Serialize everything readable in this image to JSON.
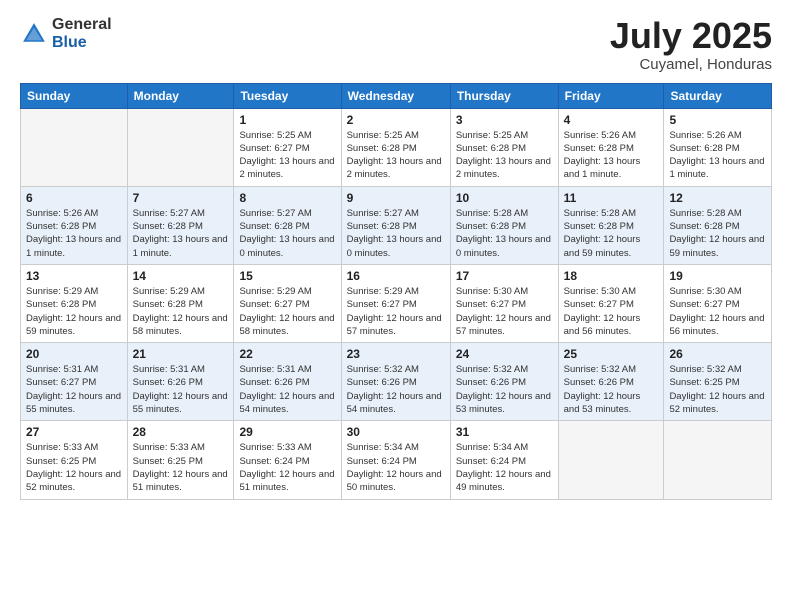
{
  "logo": {
    "general": "General",
    "blue": "Blue"
  },
  "title": "July 2025",
  "subtitle": "Cuyamel, Honduras",
  "days_of_week": [
    "Sunday",
    "Monday",
    "Tuesday",
    "Wednesday",
    "Thursday",
    "Friday",
    "Saturday"
  ],
  "weeks": [
    [
      {
        "day": "",
        "sunrise": "",
        "sunset": "",
        "daylight": ""
      },
      {
        "day": "",
        "sunrise": "",
        "sunset": "",
        "daylight": ""
      },
      {
        "day": "1",
        "sunrise": "Sunrise: 5:25 AM",
        "sunset": "Sunset: 6:27 PM",
        "daylight": "Daylight: 13 hours and 2 minutes."
      },
      {
        "day": "2",
        "sunrise": "Sunrise: 5:25 AM",
        "sunset": "Sunset: 6:28 PM",
        "daylight": "Daylight: 13 hours and 2 minutes."
      },
      {
        "day": "3",
        "sunrise": "Sunrise: 5:25 AM",
        "sunset": "Sunset: 6:28 PM",
        "daylight": "Daylight: 13 hours and 2 minutes."
      },
      {
        "day": "4",
        "sunrise": "Sunrise: 5:26 AM",
        "sunset": "Sunset: 6:28 PM",
        "daylight": "Daylight: 13 hours and 1 minute."
      },
      {
        "day": "5",
        "sunrise": "Sunrise: 5:26 AM",
        "sunset": "Sunset: 6:28 PM",
        "daylight": "Daylight: 13 hours and 1 minute."
      }
    ],
    [
      {
        "day": "6",
        "sunrise": "Sunrise: 5:26 AM",
        "sunset": "Sunset: 6:28 PM",
        "daylight": "Daylight: 13 hours and 1 minute."
      },
      {
        "day": "7",
        "sunrise": "Sunrise: 5:27 AM",
        "sunset": "Sunset: 6:28 PM",
        "daylight": "Daylight: 13 hours and 1 minute."
      },
      {
        "day": "8",
        "sunrise": "Sunrise: 5:27 AM",
        "sunset": "Sunset: 6:28 PM",
        "daylight": "Daylight: 13 hours and 0 minutes."
      },
      {
        "day": "9",
        "sunrise": "Sunrise: 5:27 AM",
        "sunset": "Sunset: 6:28 PM",
        "daylight": "Daylight: 13 hours and 0 minutes."
      },
      {
        "day": "10",
        "sunrise": "Sunrise: 5:28 AM",
        "sunset": "Sunset: 6:28 PM",
        "daylight": "Daylight: 13 hours and 0 minutes."
      },
      {
        "day": "11",
        "sunrise": "Sunrise: 5:28 AM",
        "sunset": "Sunset: 6:28 PM",
        "daylight": "Daylight: 12 hours and 59 minutes."
      },
      {
        "day": "12",
        "sunrise": "Sunrise: 5:28 AM",
        "sunset": "Sunset: 6:28 PM",
        "daylight": "Daylight: 12 hours and 59 minutes."
      }
    ],
    [
      {
        "day": "13",
        "sunrise": "Sunrise: 5:29 AM",
        "sunset": "Sunset: 6:28 PM",
        "daylight": "Daylight: 12 hours and 59 minutes."
      },
      {
        "day": "14",
        "sunrise": "Sunrise: 5:29 AM",
        "sunset": "Sunset: 6:28 PM",
        "daylight": "Daylight: 12 hours and 58 minutes."
      },
      {
        "day": "15",
        "sunrise": "Sunrise: 5:29 AM",
        "sunset": "Sunset: 6:27 PM",
        "daylight": "Daylight: 12 hours and 58 minutes."
      },
      {
        "day": "16",
        "sunrise": "Sunrise: 5:29 AM",
        "sunset": "Sunset: 6:27 PM",
        "daylight": "Daylight: 12 hours and 57 minutes."
      },
      {
        "day": "17",
        "sunrise": "Sunrise: 5:30 AM",
        "sunset": "Sunset: 6:27 PM",
        "daylight": "Daylight: 12 hours and 57 minutes."
      },
      {
        "day": "18",
        "sunrise": "Sunrise: 5:30 AM",
        "sunset": "Sunset: 6:27 PM",
        "daylight": "Daylight: 12 hours and 56 minutes."
      },
      {
        "day": "19",
        "sunrise": "Sunrise: 5:30 AM",
        "sunset": "Sunset: 6:27 PM",
        "daylight": "Daylight: 12 hours and 56 minutes."
      }
    ],
    [
      {
        "day": "20",
        "sunrise": "Sunrise: 5:31 AM",
        "sunset": "Sunset: 6:27 PM",
        "daylight": "Daylight: 12 hours and 55 minutes."
      },
      {
        "day": "21",
        "sunrise": "Sunrise: 5:31 AM",
        "sunset": "Sunset: 6:26 PM",
        "daylight": "Daylight: 12 hours and 55 minutes."
      },
      {
        "day": "22",
        "sunrise": "Sunrise: 5:31 AM",
        "sunset": "Sunset: 6:26 PM",
        "daylight": "Daylight: 12 hours and 54 minutes."
      },
      {
        "day": "23",
        "sunrise": "Sunrise: 5:32 AM",
        "sunset": "Sunset: 6:26 PM",
        "daylight": "Daylight: 12 hours and 54 minutes."
      },
      {
        "day": "24",
        "sunrise": "Sunrise: 5:32 AM",
        "sunset": "Sunset: 6:26 PM",
        "daylight": "Daylight: 12 hours and 53 minutes."
      },
      {
        "day": "25",
        "sunrise": "Sunrise: 5:32 AM",
        "sunset": "Sunset: 6:26 PM",
        "daylight": "Daylight: 12 hours and 53 minutes."
      },
      {
        "day": "26",
        "sunrise": "Sunrise: 5:32 AM",
        "sunset": "Sunset: 6:25 PM",
        "daylight": "Daylight: 12 hours and 52 minutes."
      }
    ],
    [
      {
        "day": "27",
        "sunrise": "Sunrise: 5:33 AM",
        "sunset": "Sunset: 6:25 PM",
        "daylight": "Daylight: 12 hours and 52 minutes."
      },
      {
        "day": "28",
        "sunrise": "Sunrise: 5:33 AM",
        "sunset": "Sunset: 6:25 PM",
        "daylight": "Daylight: 12 hours and 51 minutes."
      },
      {
        "day": "29",
        "sunrise": "Sunrise: 5:33 AM",
        "sunset": "Sunset: 6:24 PM",
        "daylight": "Daylight: 12 hours and 51 minutes."
      },
      {
        "day": "30",
        "sunrise": "Sunrise: 5:34 AM",
        "sunset": "Sunset: 6:24 PM",
        "daylight": "Daylight: 12 hours and 50 minutes."
      },
      {
        "day": "31",
        "sunrise": "Sunrise: 5:34 AM",
        "sunset": "Sunset: 6:24 PM",
        "daylight": "Daylight: 12 hours and 49 minutes."
      },
      {
        "day": "",
        "sunrise": "",
        "sunset": "",
        "daylight": ""
      },
      {
        "day": "",
        "sunrise": "",
        "sunset": "",
        "daylight": ""
      }
    ]
  ],
  "colors": {
    "header_bg": "#2176c7",
    "header_text": "#ffffff",
    "row_odd": "#ffffff",
    "row_even": "#e8f0f9"
  }
}
